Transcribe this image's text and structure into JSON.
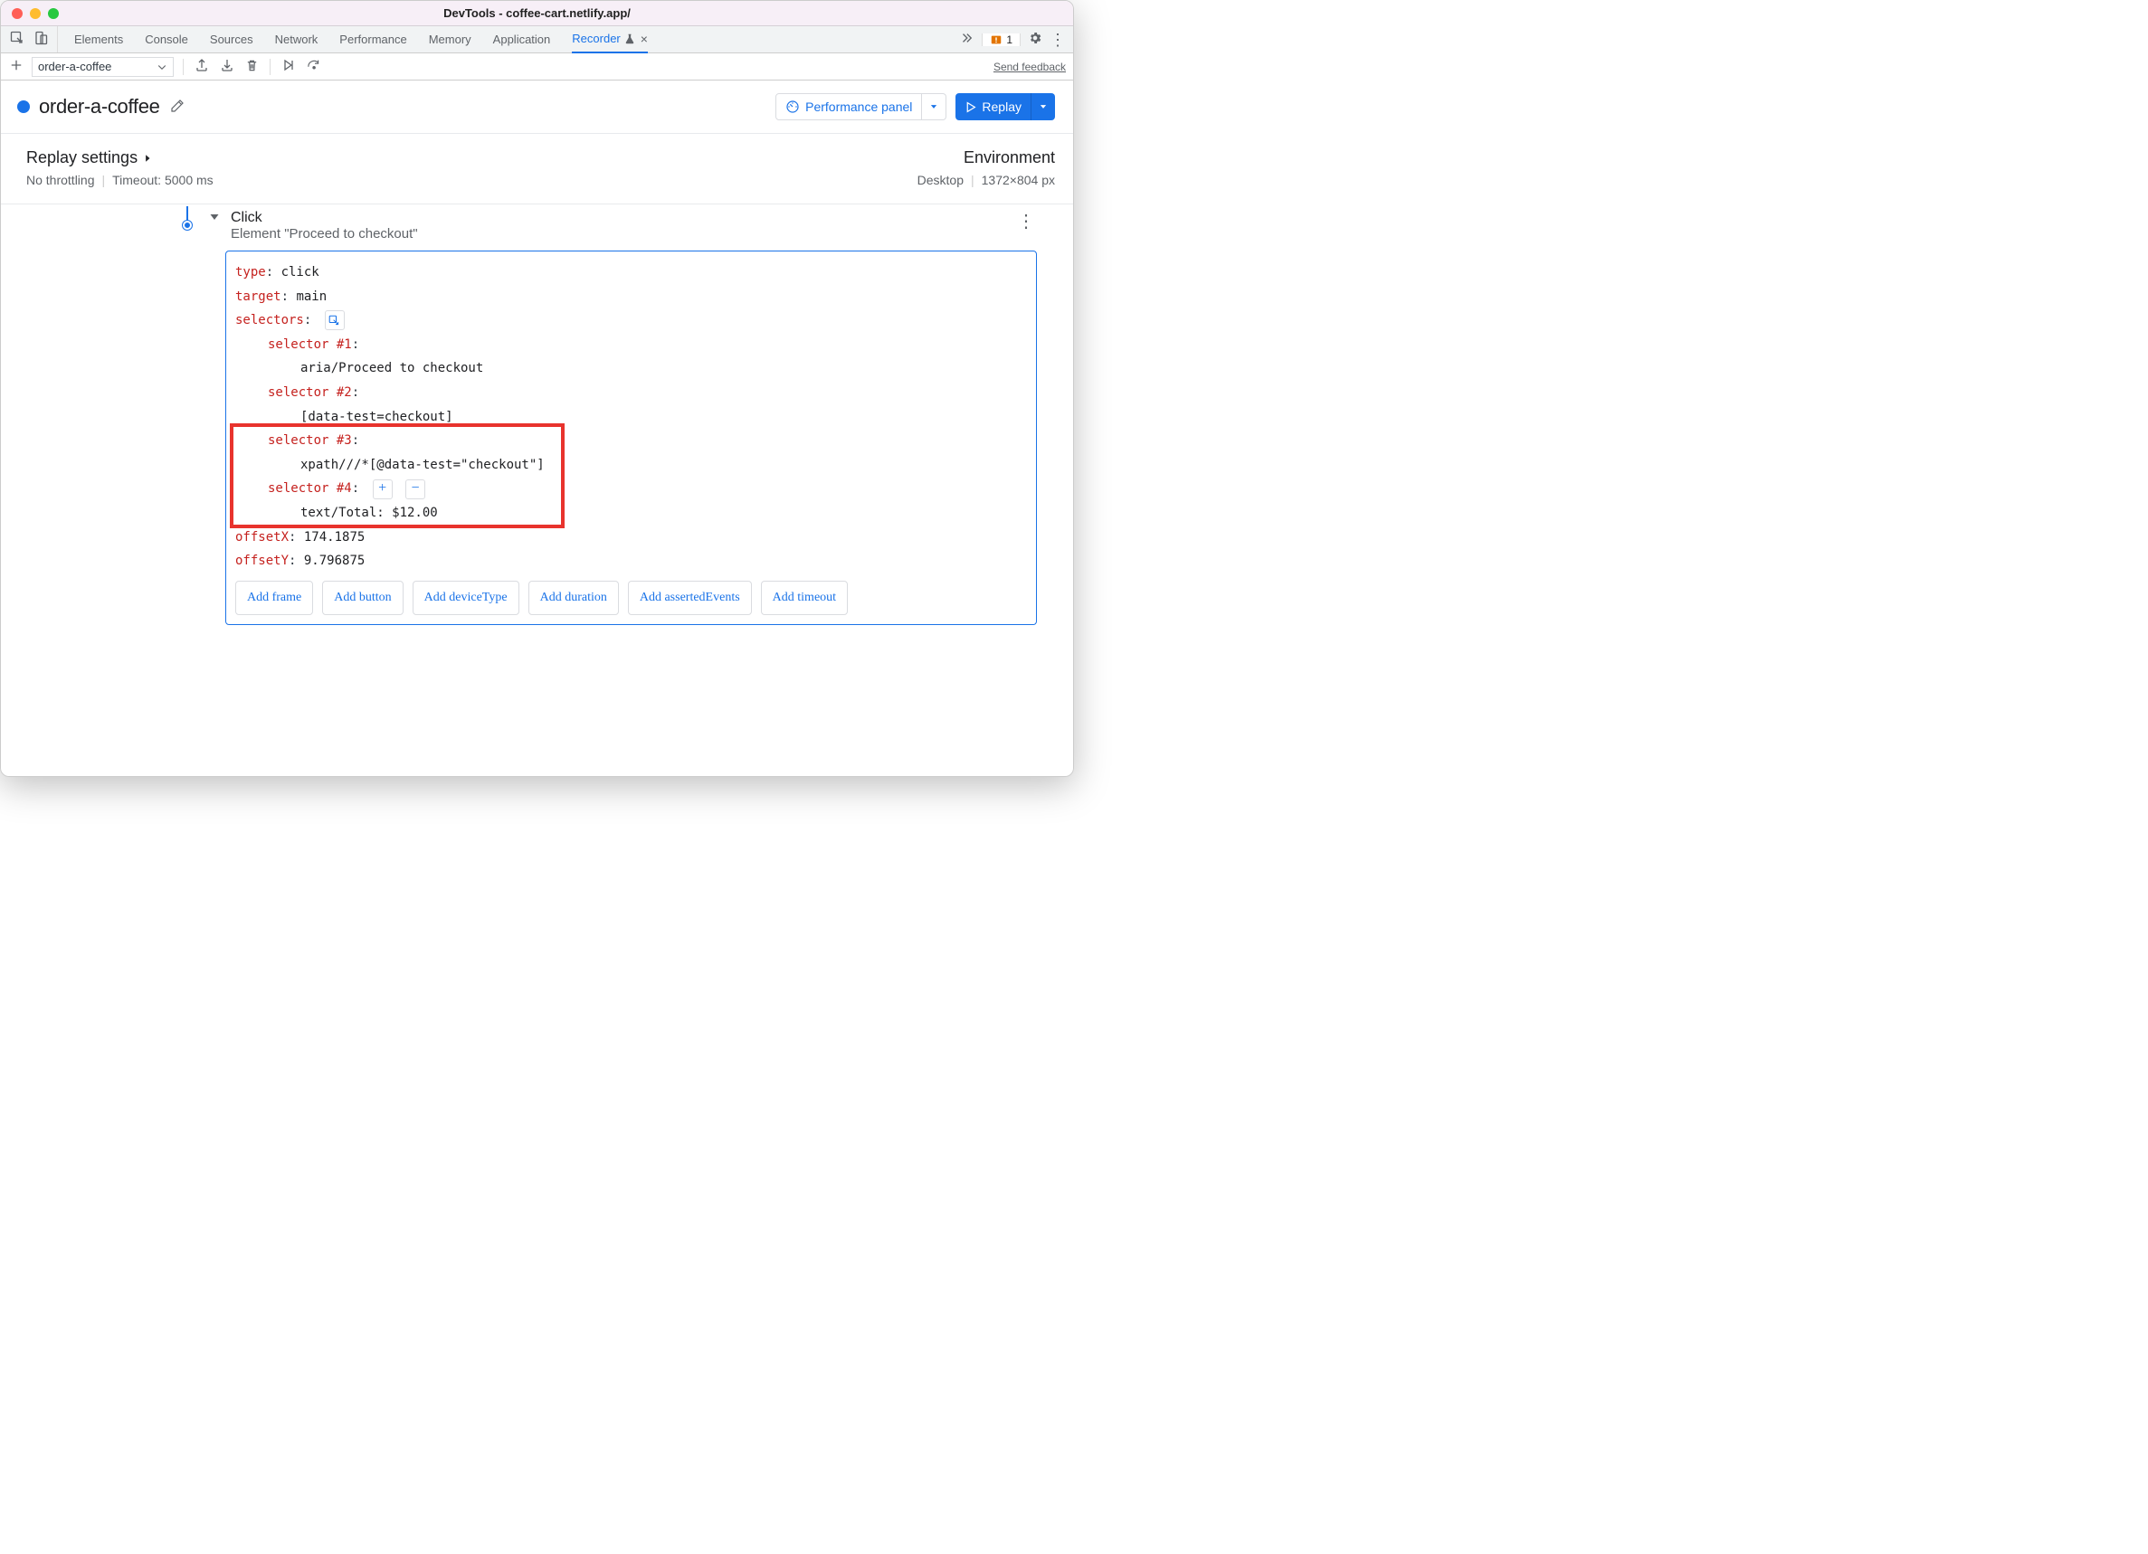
{
  "window": {
    "title": "DevTools - coffee-cart.netlify.app/"
  },
  "tabs": {
    "items": [
      "Elements",
      "Console",
      "Sources",
      "Network",
      "Performance",
      "Memory",
      "Application",
      "Recorder"
    ],
    "active_index": 7,
    "issues_count": "1"
  },
  "toolbar": {
    "recording_name": "order-a-coffee",
    "feedback_label": "Send feedback"
  },
  "header": {
    "recording_title": "order-a-coffee",
    "perf_button": "Performance panel",
    "replay_button": "Replay"
  },
  "settings": {
    "replay_label": "Replay settings",
    "throttling": "No throttling",
    "timeout": "Timeout: 5000 ms",
    "env_label": "Environment",
    "env_device": "Desktop",
    "env_size": "1372×804 px"
  },
  "step": {
    "title": "Click",
    "subtitle": "Element \"Proceed to checkout\"",
    "type_label": "type",
    "type_value": "click",
    "target_label": "target",
    "target_value": "main",
    "selectors_label": "selectors",
    "sel1_label": "selector #1",
    "sel1_value": "aria/Proceed to checkout",
    "sel2_label": "selector #2",
    "sel2_value": "[data-test=checkout]",
    "sel3_label": "selector #3",
    "sel3_value": "xpath///*[@data-test=\"checkout\"]",
    "sel4_label": "selector #4",
    "sel4_value": "text/Total: $12.00",
    "offsetX_label": "offsetX",
    "offsetX_value": "174.1875",
    "offsetY_label": "offsetY",
    "offsetY_value": "9.796875",
    "chips": [
      "Add frame",
      "Add button",
      "Add deviceType",
      "Add duration",
      "Add assertedEvents",
      "Add timeout"
    ]
  }
}
